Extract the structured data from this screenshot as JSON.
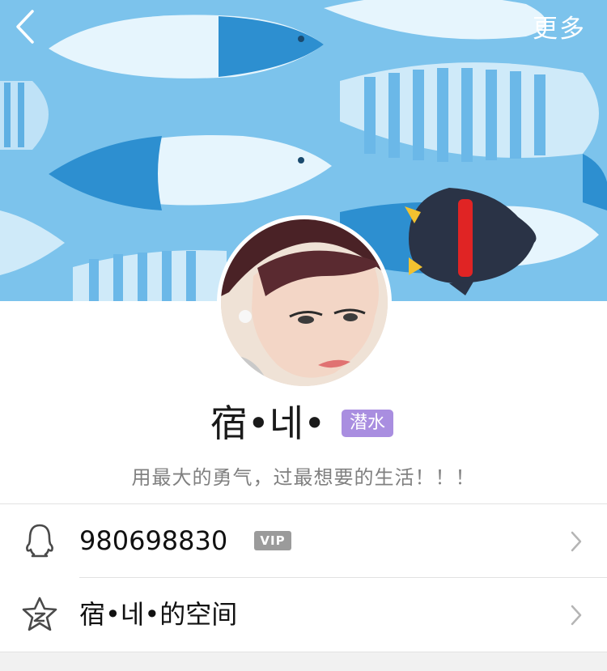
{
  "header": {
    "back_icon": "chevron-left-icon",
    "more_label": "更多"
  },
  "profile": {
    "name": "宿•네•",
    "status_badge": "潜水",
    "status_color": "#a98ee0",
    "signature": "用最大的勇气，过最想要的生活！！！"
  },
  "rows": [
    {
      "icon": "qq-penguin-icon",
      "label": "980698830",
      "badge": "VIP"
    },
    {
      "icon": "qzone-star-icon",
      "label": "宿•네•的空间"
    }
  ],
  "colors": {
    "banner_sky": "#7cc3ec",
    "fish_light": "#e6f5fd",
    "fish_blue": "#2d8fd0",
    "mascot_body": "#2a3346",
    "mascot_scarf": "#e02424"
  }
}
